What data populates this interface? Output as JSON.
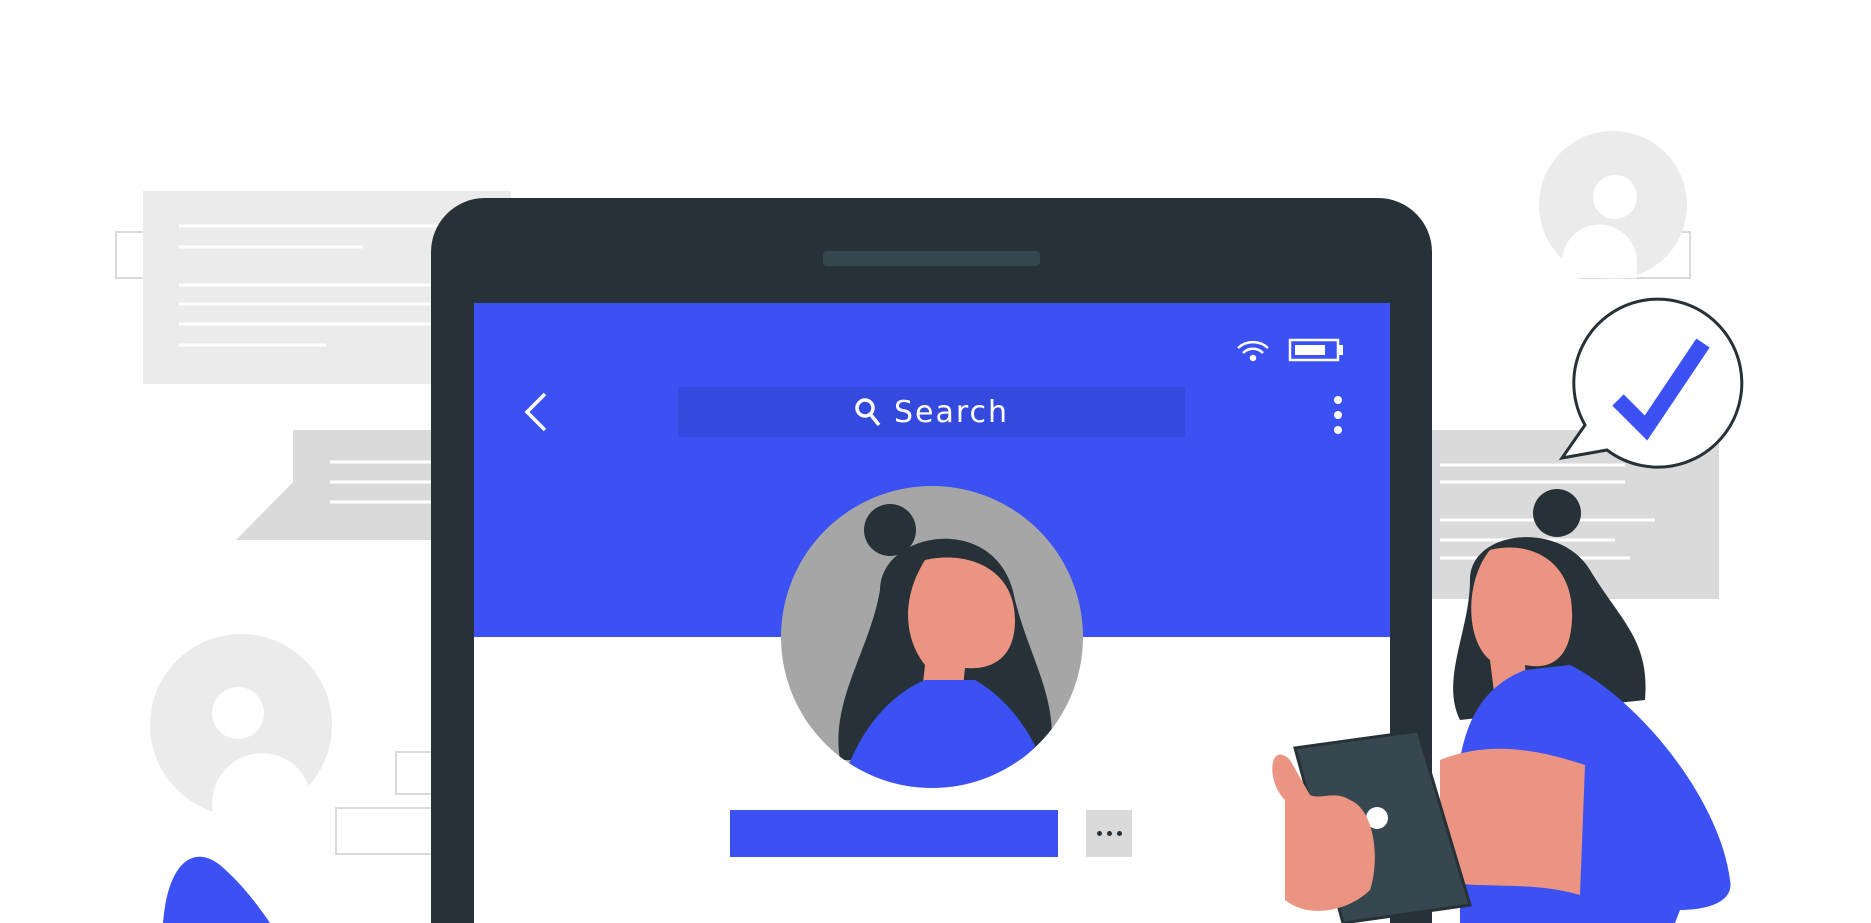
{
  "search": {
    "label": "Search",
    "icon": "search-icon"
  },
  "status_bar": {
    "icons": [
      "wifi-icon",
      "battery-icon"
    ]
  },
  "colors": {
    "brand": "#3b51f3",
    "search_bg": "#3449dd",
    "device": "#263238",
    "avatar_bg": "#a6a6a6",
    "skin": "#eb9481",
    "background_shapes": "#ebebeb"
  }
}
